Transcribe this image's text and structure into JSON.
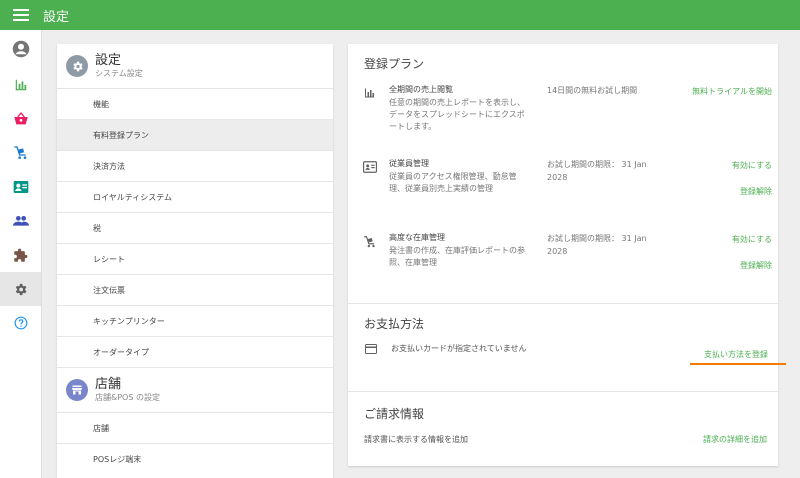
{
  "app": {
    "title": "設定"
  },
  "sidenav": {
    "items": [
      {
        "icon": "account-icon",
        "active": false
      },
      {
        "icon": "bar-chart-icon",
        "active": false
      },
      {
        "icon": "basket-icon",
        "active": false
      },
      {
        "icon": "cart-icon",
        "active": false
      },
      {
        "icon": "id-card-icon",
        "active": false
      },
      {
        "icon": "people-icon",
        "active": false
      },
      {
        "icon": "puzzle-icon",
        "active": false
      },
      {
        "icon": "gear-icon",
        "active": true
      },
      {
        "icon": "help-icon",
        "active": false
      }
    ]
  },
  "settings": {
    "system": {
      "title": "設定",
      "subtitle": "システム設定",
      "items": [
        "機能",
        "有料登録プラン",
        "決済方法",
        "ロイヤルティシステム",
        "税",
        "レシート",
        "注文伝票",
        "キッチンプリンター",
        "オーダータイプ"
      ],
      "active_index": 1
    },
    "store": {
      "title": "店舗",
      "subtitle": "店舗&POS の設定",
      "items": [
        "店舗",
        "POSレジ端末"
      ]
    }
  },
  "plans": {
    "title": "登録プラン",
    "rows": [
      {
        "icon": "bar-chart-icon",
        "name": "全期間の売上閲覧",
        "description": "任意の期間の売上レポートを表示し、データをスプレッドシートにエクスポートします。",
        "term": "14日間の無料お試し期間",
        "actions": [
          "無料トライアルを開始"
        ]
      },
      {
        "icon": "id-card-icon",
        "name": "従業員管理",
        "description": "従業員のアクセス権限管理、勤怠管理、従業員別売上実績の管理",
        "term": "お試し期間の期限： 31 Jan 2028",
        "actions": [
          "有効にする",
          "登録解除"
        ]
      },
      {
        "icon": "cart-icon",
        "name": "高度な在庫管理",
        "description": "発注書の作成、在庫評価レポートの参照、在庫管理",
        "term": "お試し期間の期限： 31 Jan 2028",
        "actions": [
          "有効にする",
          "登録解除"
        ]
      }
    ]
  },
  "payment": {
    "title": "お支払方法",
    "status": "お支払いカードが指定されていません",
    "action": "支払い方法を登録",
    "icon": "credit-card-icon"
  },
  "billing": {
    "title": "ご請求情報",
    "description": "請求書に表示する情報を追加",
    "action": "請求の詳細を追加"
  },
  "colors": {
    "brand": "#4caf50",
    "highlight": "#f57c00",
    "basket": "#e91e63",
    "cart": "#1976d2",
    "idcard": "#009688",
    "people": "#3f51b5",
    "puzzle": "#795548",
    "help": "#2196f3"
  }
}
